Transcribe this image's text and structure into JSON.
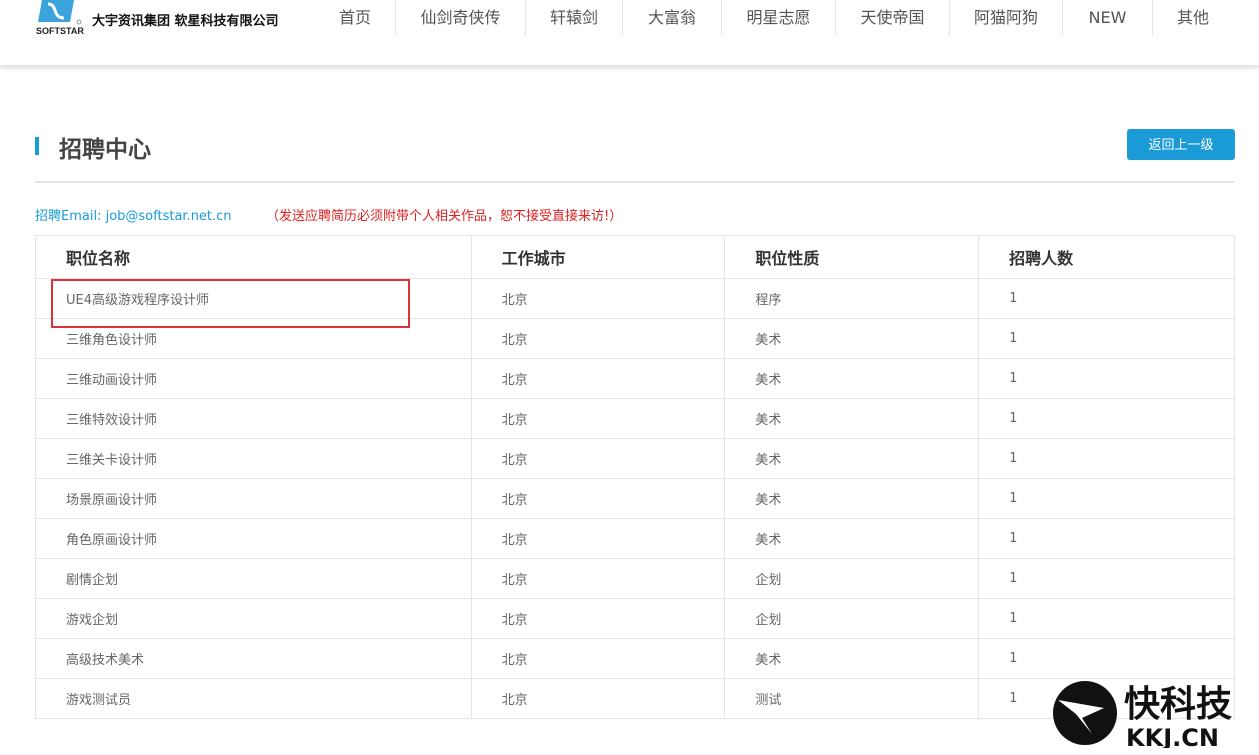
{
  "header": {
    "logo_text": "SOFTSTAR",
    "company": "大宇资讯集团 软星科技有限公司",
    "nav": [
      "首页",
      "仙剑奇侠传",
      "轩辕剑",
      "大富翁",
      "明星志愿",
      "天使帝国",
      "阿猫阿狗",
      "NEW",
      "其他"
    ]
  },
  "page": {
    "title": "招聘中心",
    "back_label": "返回上一级",
    "email": "招聘Email: job@softstar.net.cn",
    "notice": "（发送应聘简历必须附带个人相关作品，恕不接受直接来访!）"
  },
  "table": {
    "headers": [
      "职位名称",
      "工作城市",
      "职位性质",
      "招聘人数"
    ],
    "rows": [
      [
        "UE4高级游戏程序设计师",
        "北京",
        "程序",
        "1"
      ],
      [
        "三维角色设计师",
        "北京",
        "美术",
        "1"
      ],
      [
        "三维动画设计师",
        "北京",
        "美术",
        "1"
      ],
      [
        "三维特效设计师",
        "北京",
        "美术",
        "1"
      ],
      [
        "三维关卡设计师",
        "北京",
        "美术",
        "1"
      ],
      [
        "场景原画设计师",
        "北京",
        "美术",
        "1"
      ],
      [
        "角色原画设计师",
        "北京",
        "美术",
        "1"
      ],
      [
        "剧情企划",
        "北京",
        "企划",
        "1"
      ],
      [
        "游戏企划",
        "北京",
        "企划",
        "1"
      ],
      [
        "高级技术美术",
        "北京",
        "美术",
        "1"
      ],
      [
        "游戏测试员",
        "北京",
        "测试",
        "1"
      ]
    ]
  },
  "watermark": {
    "text": "快科技",
    "sub": "KKJ.CN"
  }
}
